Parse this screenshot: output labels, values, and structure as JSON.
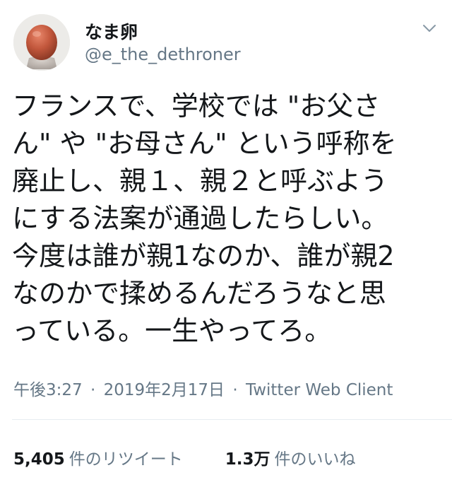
{
  "user": {
    "display_name": "なま卵",
    "handle": "@e_the_dethroner",
    "avatar_icon": "egg-avatar-icon"
  },
  "tweet": {
    "text": "フランスで、学校では \"お父さ\nん\" や \"お母さん\" という呼称を\n廃止し、親１、親２と呼ぶよう\nにする法案が通過したらしい。\n今度は誰が親1なのか、誰が親2\nなのかで揉めるんだろうなと思\nっている。一生やってろ。",
    "time": "午後3:27",
    "separator": "·",
    "date": "2019年2月17日",
    "client": "Twitter Web Client"
  },
  "stats": {
    "retweets_count": "5,405",
    "retweets_label": "件のリツイート",
    "likes_count": "1.3万",
    "likes_label": "件のいいね"
  },
  "colors": {
    "text": "#14171a",
    "secondary": "#657786",
    "divider": "#e6ecf0",
    "avatar_egg": "#c2573c"
  },
  "icons": {
    "more": "chevron-down-icon"
  }
}
